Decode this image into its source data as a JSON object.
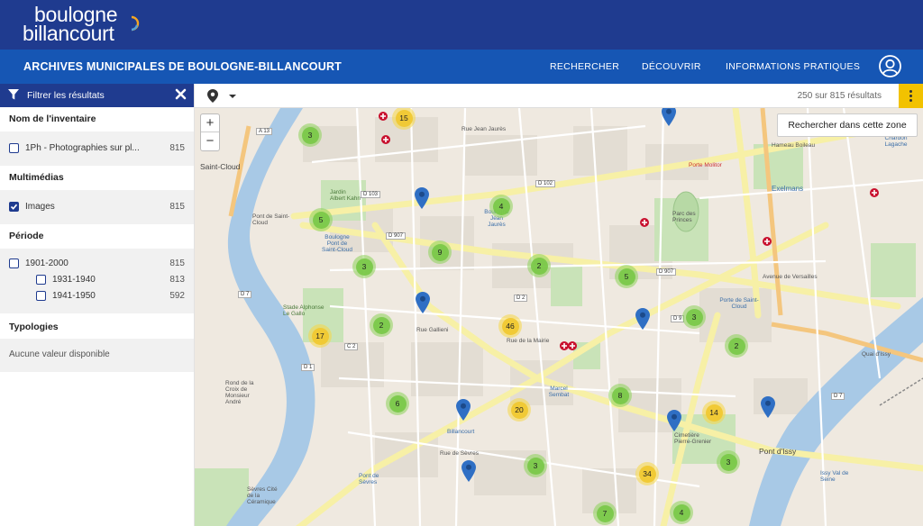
{
  "header": {
    "logo_line1": "boulogne",
    "logo_line2": "billancourt",
    "site_title": "ARCHIVES MUNICIPALES DE BOULOGNE-BILLANCOURT",
    "nav": [
      "RECHERCHER",
      "DÉCOUVRIR",
      "INFORMATIONS PRATIQUES"
    ]
  },
  "filters": {
    "title": "Filtrer les résultats",
    "sections": {
      "inventory": {
        "title": "Nom de l'inventaire",
        "items": [
          {
            "label": "1Ph - Photographies sur pl...",
            "count": "815",
            "checked": false
          }
        ]
      },
      "media": {
        "title": "Multimédias",
        "items": [
          {
            "label": "Images",
            "count": "815",
            "checked": true
          }
        ]
      },
      "period": {
        "title": "Période",
        "items": [
          {
            "label": "1901-2000",
            "count": "815",
            "checked": false
          },
          {
            "label": "1931-1940",
            "count": "813",
            "checked": false
          },
          {
            "label": "1941-1950",
            "count": "592",
            "checked": false
          }
        ]
      },
      "typologies": {
        "title": "Typologies",
        "empty": "Aucune valeur disponible"
      }
    }
  },
  "map_toolbar": {
    "result_count": "250 sur 815 résultats"
  },
  "map": {
    "zoom_in": "+",
    "zoom_out": "−",
    "search_zone": "Rechercher dans cette zone",
    "clusters": [
      {
        "count": "3",
        "color": "green"
      },
      {
        "count": "15",
        "color": "yellow"
      },
      {
        "count": "5",
        "color": "green"
      },
      {
        "count": "4",
        "color": "green"
      },
      {
        "count": "9",
        "color": "green"
      },
      {
        "count": "3",
        "color": "green"
      },
      {
        "count": "2",
        "color": "green"
      },
      {
        "count": "5",
        "color": "green"
      },
      {
        "count": "2",
        "color": "green"
      },
      {
        "count": "46",
        "color": "yellow"
      },
      {
        "count": "17",
        "color": "yellow"
      },
      {
        "count": "3",
        "color": "green"
      },
      {
        "count": "2",
        "color": "green"
      },
      {
        "count": "6",
        "color": "green"
      },
      {
        "count": "20",
        "color": "yellow"
      },
      {
        "count": "8",
        "color": "green"
      },
      {
        "count": "14",
        "color": "yellow"
      },
      {
        "count": "3",
        "color": "green"
      },
      {
        "count": "34",
        "color": "yellow"
      },
      {
        "count": "3",
        "color": "green"
      },
      {
        "count": "7",
        "color": "green"
      },
      {
        "count": "4",
        "color": "green"
      }
    ],
    "labels": {
      "saint_cloud": "Saint-Cloud",
      "pont_saint_cloud": "Pont de Saint-Cloud",
      "boulogne_pont": "Boulogne Pont de Saint-Cloud",
      "boulogne_jaures": "Boulogne Jean Jaurès",
      "porte_molitor": "Porte Molitor",
      "exelmans": "Exelmans",
      "porte_saint_cloud": "Porte de Saint-Cloud",
      "marcel_sembat": "Marcel Sembat",
      "billancourt": "Billancourt",
      "pont_sevres": "Pont de Sèvres",
      "pont_issy": "Pont d'Issy",
      "issy_val": "Issy Val de Seine",
      "rue_gallieni": "Rue Gallieni",
      "rue_sevres": "Rue de Sèvres",
      "jardin_albert_kahn": "Jardin Albert Kahn",
      "stade_le_gallo": "Stade Alphonse Le Gallo",
      "cimetiere": "Cimetière Pierre-Grenier",
      "avenue_versailles": "Avenue de Versailles",
      "quai_issy": "Quai d'Issy",
      "hameau_boileau": "Hameau Boileau",
      "chardon_lagache": "Chardon Lagache",
      "parc_princes": "Parc des Princes",
      "rue_de_la_mairie": "Rue de la Mairie",
      "rond_point": "Rond de la Croix de Monsieur André",
      "sevres_ceramique": "Sèvres Cité de la Céramique",
      "rue_jean_jaures": "Rue Jean Jaurès"
    },
    "roads": [
      "A 13",
      "D 103",
      "D 102",
      "D 907",
      "D 907",
      "D 2",
      "D 9",
      "D 7",
      "C 2",
      "D 1",
      "D 7"
    ]
  }
}
